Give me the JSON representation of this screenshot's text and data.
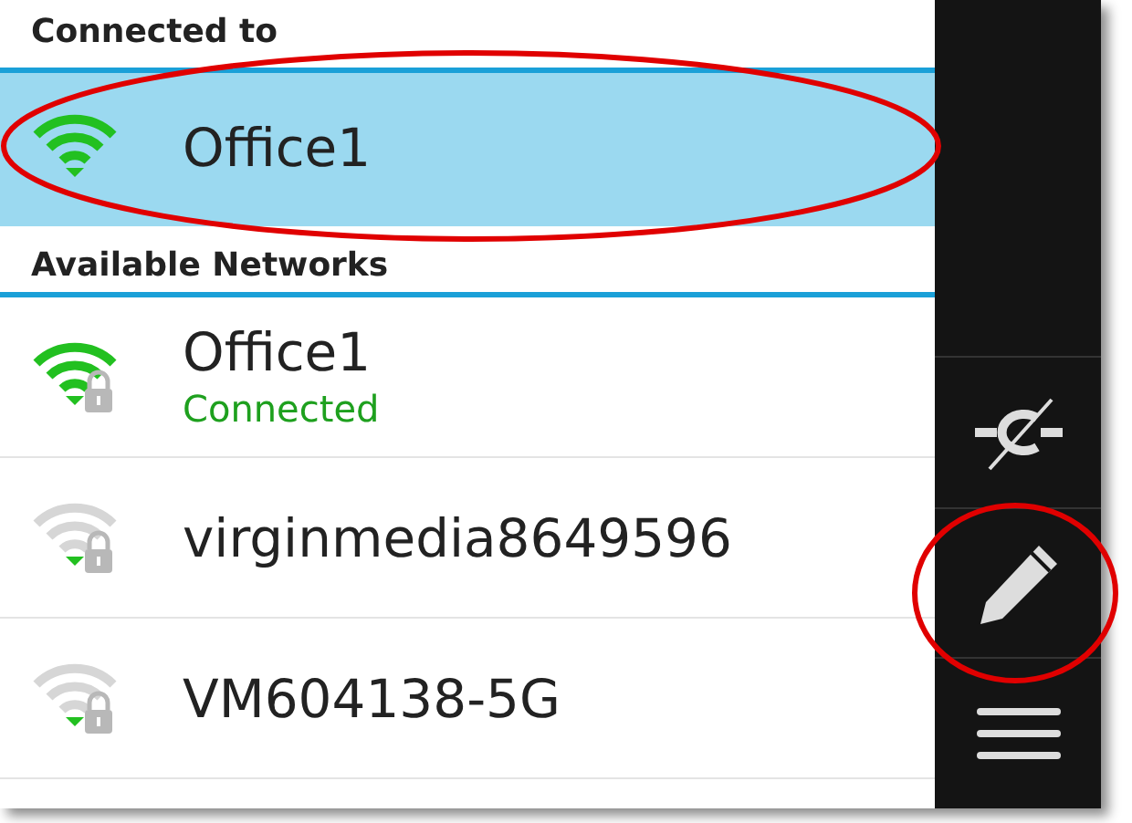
{
  "connected_header": "Connected to",
  "current_network": {
    "name": "Office1",
    "selected": true,
    "connected": true
  },
  "available_header": "Available Networks",
  "networks": [
    {
      "name": "Office1",
      "status": "Connected",
      "connected": true,
      "secured": true
    },
    {
      "name": "virginmedia8649596",
      "connected": false,
      "secured": true
    },
    {
      "name": "VM604138-5G",
      "connected": false,
      "secured": true
    }
  ],
  "action_bar": [
    {
      "kind": "disconnect"
    },
    {
      "kind": "edit"
    },
    {
      "kind": "menu"
    }
  ],
  "annotations": [
    {
      "kind": "ellipse"
    },
    {
      "kind": "ellipse"
    }
  ]
}
